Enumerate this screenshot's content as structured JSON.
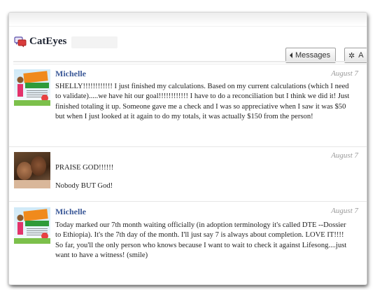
{
  "header": {
    "title": "CatEyes",
    "messages_button": "Messages",
    "actions_button": "A"
  },
  "messages": [
    {
      "sender": "Michelle",
      "time": "August 7",
      "avatar": "zumba-flyer-avatar",
      "body": [
        "SHELLY!!!!!!!!!!!! I just finished my calculations. Based on my current calculations (which I need to validate).....we have hit our goal!!!!!!!!!!!! I have to do a reconciliation but I think we did it! Just finished totaling it up. Someone gave me a check and I was so appreciative when I saw it was $50 but when I just looked at it again to do my totals, it was actually $150 from the person!"
      ]
    },
    {
      "sender": "",
      "time": "August 7",
      "avatar": "couple-photo-avatar",
      "body": [
        "PRAISE GOD!!!!!!",
        "Nobody BUT God!"
      ]
    },
    {
      "sender": "Michelle",
      "time": "August 7",
      "avatar": "zumba-flyer-avatar",
      "body": [
        "Today marked our 7th month waiting officially (in adoption terminology it's called DTE --Dossier to Ethiopia). It's the 7th day of the month. I'll just say 7 is always about completion. LOVE IT!!!! So far, you'll the only person who knows because I want to wait to check it against Lifesong....just want to have a witness! (smile)"
      ]
    }
  ],
  "icons": {
    "chat": "chat-bubbles-icon",
    "back": "caret-left-icon",
    "actions": "gear-icon"
  },
  "colors": {
    "sender_link": "#3b5998",
    "timestamp": "#9a9a9a"
  }
}
